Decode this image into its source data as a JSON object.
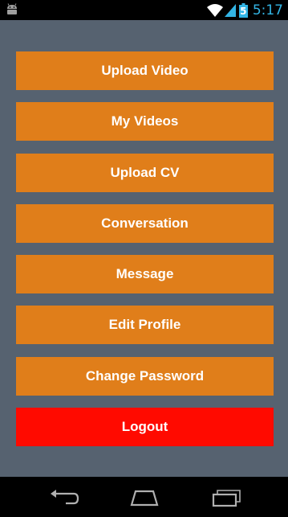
{
  "status_bar": {
    "time": "5:17",
    "battery_level": "5",
    "icons": [
      "android-icon",
      "wifi-icon",
      "signal-icon",
      "battery-icon"
    ]
  },
  "colors": {
    "background": "#566270",
    "button": "#e07e1a",
    "logout": "#ff0a00",
    "clock": "#33b5e5"
  },
  "menu": {
    "items": [
      {
        "label": "Upload Video",
        "name": "upload-video-button",
        "color": "#e07e1a"
      },
      {
        "label": "My Videos",
        "name": "my-videos-button",
        "color": "#e07e1a"
      },
      {
        "label": "Upload CV",
        "name": "upload-cv-button",
        "color": "#e07e1a"
      },
      {
        "label": "Conversation",
        "name": "conversation-button",
        "color": "#e07e1a"
      },
      {
        "label": "Message",
        "name": "message-button",
        "color": "#e07e1a"
      },
      {
        "label": "Edit Profile",
        "name": "edit-profile-button",
        "color": "#e07e1a"
      },
      {
        "label": "Change Password",
        "name": "change-password-button",
        "color": "#e07e1a"
      },
      {
        "label": "Logout",
        "name": "logout-button",
        "color": "#ff0a00"
      }
    ]
  },
  "nav_bar": {
    "icons": [
      "back-icon",
      "home-icon",
      "recent-apps-icon"
    ]
  }
}
